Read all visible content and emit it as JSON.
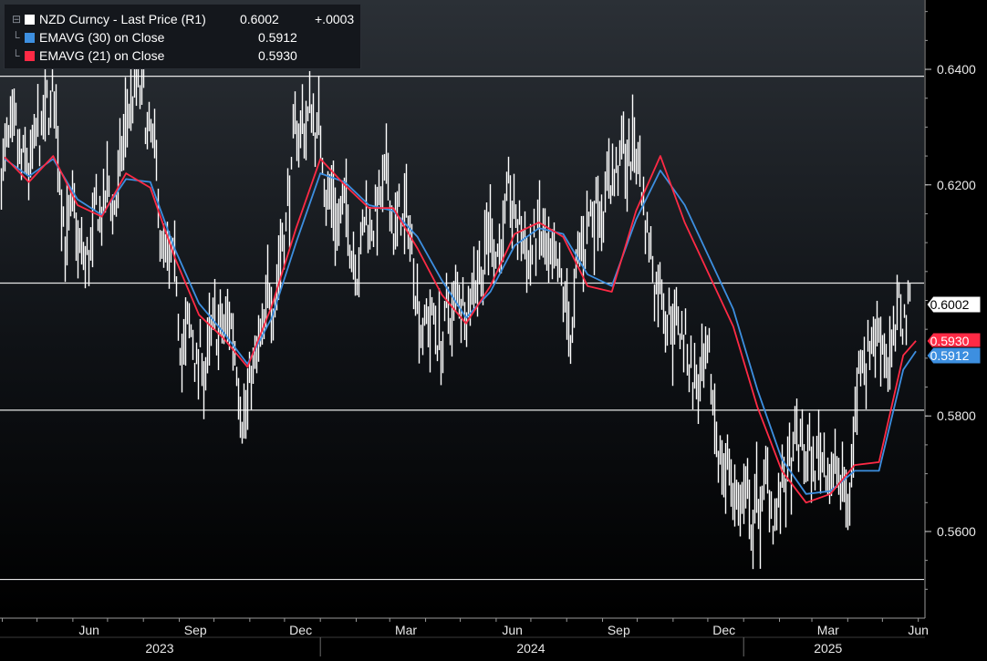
{
  "legend": {
    "items": [
      {
        "name": "NZD Curncy - Last Price (R1)",
        "value": "0.6002",
        "change": "+.0003",
        "color": "#ffffff"
      },
      {
        "name": "EMAVG (30)  on Close",
        "value": "0.5912",
        "change": "",
        "color": "#3d8fe0"
      },
      {
        "name": "EMAVG (21)  on Close",
        "value": "0.5930",
        "change": "",
        "color": "#ff2a45"
      }
    ]
  },
  "chart_data": {
    "type": "line",
    "x_axis": {
      "month_labels": [
        "Jun",
        "Sep",
        "Dec",
        "Mar",
        "Jun",
        "Sep",
        "Dec",
        "Mar",
        "Jun"
      ],
      "year_labels": [
        "2023",
        "2024",
        "2025"
      ]
    },
    "y_axis": {
      "position": "right",
      "range": [
        0.545,
        0.652
      ],
      "ticks": [
        "0.6400",
        "0.6200",
        "0.5800",
        "0.5600"
      ],
      "reference_lines": [
        0.6388,
        0.603,
        0.581,
        0.5517
      ]
    },
    "last_value_tags": [
      {
        "label": "0.6002",
        "value": 0.6002,
        "color": "#ffffff"
      },
      {
        "label": "0.5930",
        "value": 0.593,
        "color": "#ff2a45"
      },
      {
        "label": "0.5912",
        "value": 0.5912,
        "color": "#3d8fe0"
      }
    ],
    "series": [
      {
        "name": "NZD Curncy - Last Price (R1)",
        "color": "#ffffff",
        "x": [
          "2023-04-03",
          "2023-04-17",
          "2023-05-01",
          "2023-05-15",
          "2023-05-29",
          "2023-06-12",
          "2023-06-26",
          "2023-07-10",
          "2023-07-24",
          "2023-08-07",
          "2023-08-21",
          "2023-09-04",
          "2023-09-18",
          "2023-10-02",
          "2023-10-16",
          "2023-10-30",
          "2023-11-13",
          "2023-11-27",
          "2023-12-11",
          "2023-12-25",
          "2024-01-08",
          "2024-01-22",
          "2024-02-05",
          "2024-02-19",
          "2024-03-04",
          "2024-03-18",
          "2024-04-01",
          "2024-04-15",
          "2024-04-29",
          "2024-05-13",
          "2024-05-27",
          "2024-06-10",
          "2024-06-24",
          "2024-07-08",
          "2024-07-22",
          "2024-08-05",
          "2024-08-19",
          "2024-09-02",
          "2024-09-16",
          "2024-09-30",
          "2024-10-14",
          "2024-10-28",
          "2024-11-11",
          "2024-11-25",
          "2024-12-09",
          "2024-12-23",
          "2025-01-06",
          "2025-01-20",
          "2025-02-03",
          "2025-02-17",
          "2025-03-03",
          "2025-03-17",
          "2025-03-31",
          "2025-04-14",
          "2025-04-28",
          "2025-05-12",
          "2025-05-26"
        ],
        "values": [
          0.625,
          0.617,
          0.622,
          0.632,
          0.612,
          0.603,
          0.614,
          0.618,
          0.637,
          0.624,
          0.602,
          0.593,
          0.589,
          0.59,
          0.595,
          0.586,
          0.589,
          0.612,
          0.627,
          0.634,
          0.622,
          0.612,
          0.613,
          0.617,
          0.614,
          0.611,
          0.598,
          0.594,
          0.598,
          0.608,
          0.612,
          0.613,
          0.609,
          0.61,
          0.597,
          0.593,
          0.613,
          0.624,
          0.622,
          0.626,
          0.608,
          0.603,
          0.593,
          0.584,
          0.576,
          0.569,
          0.561,
          0.565,
          0.565,
          0.572,
          0.571,
          0.575,
          0.562,
          0.595,
          0.597,
          0.591,
          0.6002
        ]
      },
      {
        "name": "EMAVG (30) on Close",
        "color": "#3d8fe0",
        "x": [
          "2023-04-03",
          "2023-04-24",
          "2023-05-15",
          "2023-06-05",
          "2023-06-26",
          "2023-07-17",
          "2023-08-07",
          "2023-08-28",
          "2023-09-18",
          "2023-10-09",
          "2023-10-30",
          "2023-11-20",
          "2023-12-11",
          "2024-01-01",
          "2024-01-22",
          "2024-02-12",
          "2024-03-04",
          "2024-03-25",
          "2024-04-15",
          "2024-05-06",
          "2024-05-27",
          "2024-06-17",
          "2024-07-08",
          "2024-07-29",
          "2024-08-19",
          "2024-09-09",
          "2024-09-30",
          "2024-10-21",
          "2024-11-11",
          "2024-12-02",
          "2024-12-23",
          "2025-01-13",
          "2025-02-03",
          "2025-02-24",
          "2025-03-17",
          "2025-04-07",
          "2025-04-28",
          "2025-05-19",
          "2025-05-30"
        ],
        "values": [
          0.6245,
          0.6215,
          0.6245,
          0.6175,
          0.6148,
          0.621,
          0.6205,
          0.609,
          0.5995,
          0.5945,
          0.589,
          0.597,
          0.61,
          0.622,
          0.6205,
          0.6165,
          0.6155,
          0.611,
          0.6035,
          0.597,
          0.6015,
          0.6095,
          0.6125,
          0.6115,
          0.6045,
          0.6025,
          0.614,
          0.6225,
          0.6165,
          0.6075,
          0.5985,
          0.5845,
          0.5725,
          0.5665,
          0.567,
          0.5705,
          0.5705,
          0.588,
          0.5912
        ]
      },
      {
        "name": "EMAVG (21) on Close",
        "color": "#ff2a45",
        "x": [
          "2023-04-03",
          "2023-04-24",
          "2023-05-15",
          "2023-06-05",
          "2023-06-26",
          "2023-07-17",
          "2023-08-07",
          "2023-08-28",
          "2023-09-18",
          "2023-10-09",
          "2023-10-30",
          "2023-11-20",
          "2023-12-11",
          "2024-01-01",
          "2024-01-22",
          "2024-02-12",
          "2024-03-04",
          "2024-03-25",
          "2024-04-15",
          "2024-05-06",
          "2024-05-27",
          "2024-06-17",
          "2024-07-08",
          "2024-07-29",
          "2024-08-19",
          "2024-09-09",
          "2024-09-30",
          "2024-10-21",
          "2024-11-11",
          "2024-12-02",
          "2024-12-23",
          "2025-01-13",
          "2025-02-03",
          "2025-02-24",
          "2025-03-17",
          "2025-04-07",
          "2025-04-28",
          "2025-05-19",
          "2025-05-30"
        ],
        "values": [
          0.6248,
          0.6205,
          0.625,
          0.6165,
          0.6145,
          0.622,
          0.6195,
          0.6075,
          0.5975,
          0.5935,
          0.5885,
          0.599,
          0.6125,
          0.6245,
          0.62,
          0.616,
          0.616,
          0.609,
          0.601,
          0.596,
          0.6025,
          0.6115,
          0.6135,
          0.611,
          0.6025,
          0.6015,
          0.6155,
          0.625,
          0.6135,
          0.6045,
          0.5955,
          0.5815,
          0.5705,
          0.565,
          0.5665,
          0.5715,
          0.572,
          0.5905,
          0.593
        ]
      }
    ]
  }
}
